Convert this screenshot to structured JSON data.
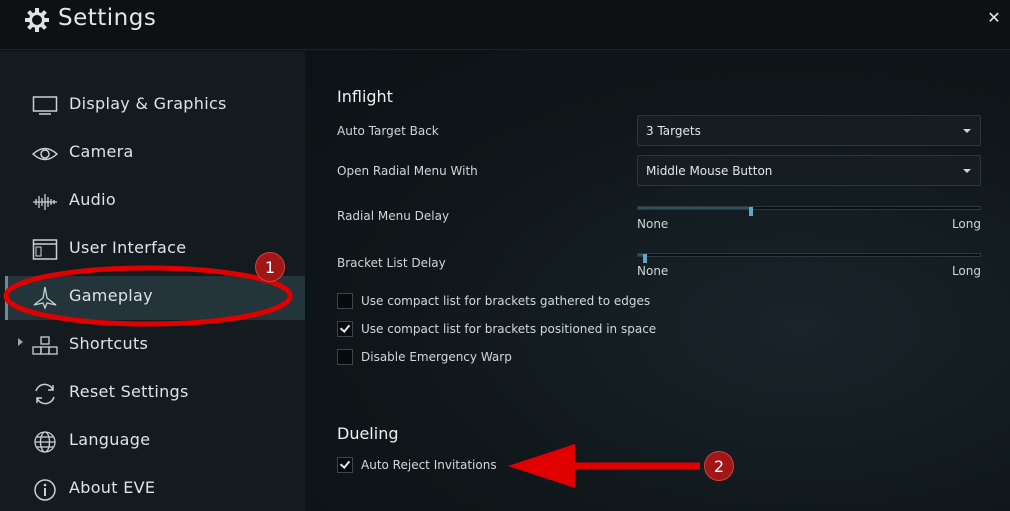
{
  "window": {
    "title": "Settings",
    "title_icon": "gear-icon",
    "close_icon": "close-icon",
    "close_glyph": "✕"
  },
  "sidebar": {
    "items": [
      {
        "label": "Display & Graphics",
        "icon": "monitor-icon"
      },
      {
        "label": "Camera",
        "icon": "eye-icon"
      },
      {
        "label": "Audio",
        "icon": "waveform-icon"
      },
      {
        "label": "User Interface",
        "icon": "window-icon"
      },
      {
        "label": "Gameplay",
        "icon": "ship-icon",
        "active": true
      },
      {
        "label": "Shortcuts",
        "icon": "keys-icon",
        "expandable": true
      },
      {
        "label": "Reset Settings",
        "icon": "reset-icon"
      },
      {
        "label": "Language",
        "icon": "globe-icon"
      },
      {
        "label": "About EVE",
        "icon": "info-icon"
      }
    ]
  },
  "inflight": {
    "title": "Inflight",
    "auto_target_back": {
      "label": "Auto Target Back",
      "value": "3 Targets"
    },
    "open_radial_menu": {
      "label": "Open Radial Menu With",
      "value": "Middle Mouse Button"
    },
    "radial_menu_delay": {
      "label": "Radial Menu Delay",
      "min_label": "None",
      "max_label": "Long",
      "level": 0.33
    },
    "bracket_list_delay": {
      "label": "Bracket List Delay",
      "min_label": "None",
      "max_label": "Long",
      "level": 0.02
    },
    "checkboxes": [
      {
        "label": "Use compact list for brackets gathered to edges",
        "checked": false
      },
      {
        "label": "Use compact list for brackets positioned in space",
        "checked": true
      },
      {
        "label": "Disable Emergency Warp",
        "checked": false
      }
    ]
  },
  "dueling": {
    "title": "Dueling",
    "checkboxes": [
      {
        "label": "Auto Reject Invitations",
        "checked": true
      }
    ]
  },
  "annotations": {
    "badge_1": "1",
    "badge_2": "2",
    "color": "#e00000"
  },
  "colors": {
    "accent": "#5fa8c4",
    "active_bg": "#24343b",
    "annotation_red": "#e00000"
  }
}
